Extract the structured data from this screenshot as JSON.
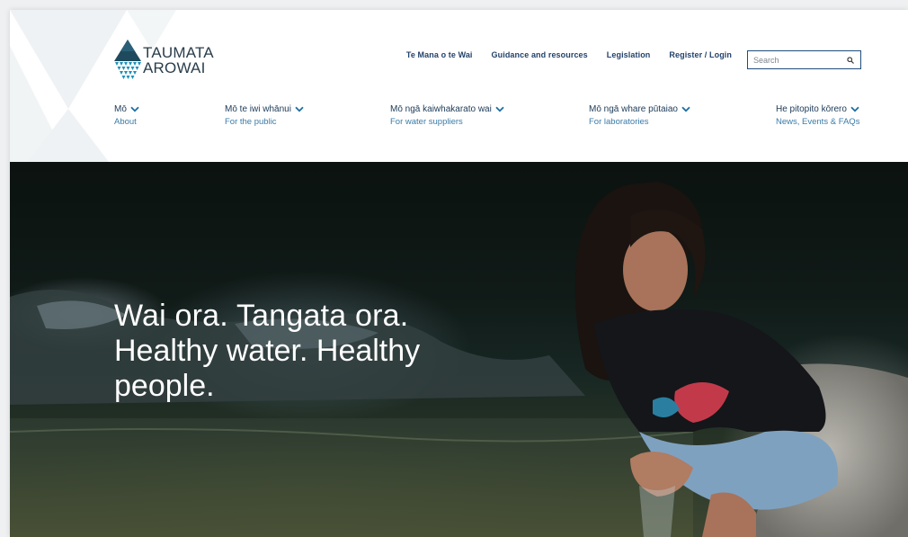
{
  "brand": {
    "line1": "TAUMATA",
    "line2": "AROWAI",
    "accent": "#1b8fb8",
    "dark": "#1f4a5e"
  },
  "utility_nav": [
    {
      "label": "Te Mana o te Wai"
    },
    {
      "label": "Guidance and resources"
    },
    {
      "label": "Legislation"
    },
    {
      "label": "Register / Login"
    }
  ],
  "search": {
    "placeholder": "Search",
    "icon": "search-icon"
  },
  "main_nav": [
    {
      "maori": "Mō",
      "english": "About"
    },
    {
      "maori": "Mō te iwi whānui",
      "english": "For the public"
    },
    {
      "maori": "Mō ngā kaiwhakarato wai",
      "english": "For water suppliers"
    },
    {
      "maori": "Mō ngā whare pūtaiao",
      "english": "For laboratories"
    },
    {
      "maori": "He pitopito kōrero",
      "english": "News, Events & FAQs"
    }
  ],
  "hero": {
    "line1": "Wai ora. Tangata ora.",
    "line2": "Healthy water. Healthy people."
  },
  "colors": {
    "nav_text": "#1b3a57",
    "nav_sub": "#3a7ba8",
    "utility_text": "#23426b",
    "chevron": "#1b6fa3"
  }
}
